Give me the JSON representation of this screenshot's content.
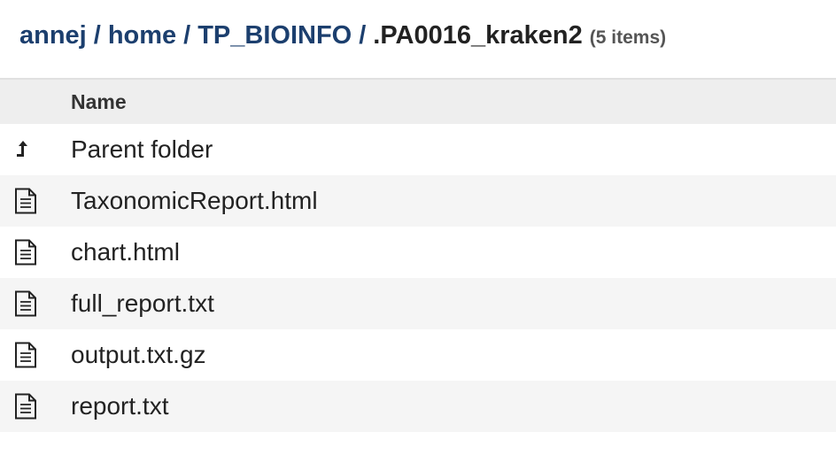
{
  "breadcrumb": {
    "items": [
      "annej",
      "home",
      "TP_BIOINFO"
    ],
    "separator": "/",
    "current": ".PA0016_kraken2",
    "count": "(5 items)"
  },
  "table": {
    "column_name": "Name",
    "rows": [
      {
        "label": "Parent folder",
        "icon": "parent-folder-icon"
      },
      {
        "label": "TaxonomicReport.html",
        "icon": "file-icon"
      },
      {
        "label": "chart.html",
        "icon": "file-icon"
      },
      {
        "label": "full_report.txt",
        "icon": "file-icon"
      },
      {
        "label": "output.txt.gz",
        "icon": "file-icon"
      },
      {
        "label": "report.txt",
        "icon": "file-icon"
      }
    ]
  },
  "colors": {
    "link": "#1c3f6e",
    "header_bg": "#eeeeee",
    "stripe_bg": "#f5f5f5"
  }
}
